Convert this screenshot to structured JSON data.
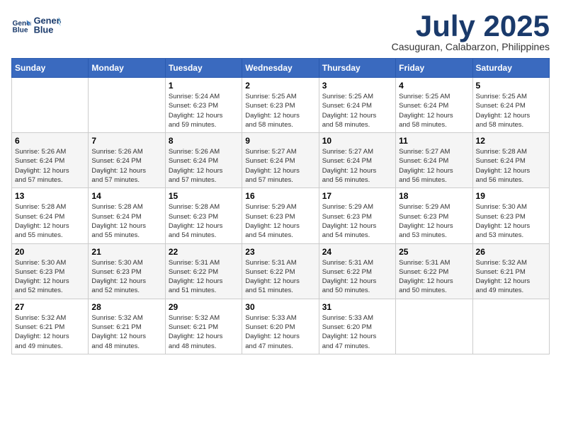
{
  "header": {
    "logo_line1": "General",
    "logo_line2": "Blue",
    "month": "July 2025",
    "location": "Casuguran, Calabarzon, Philippines"
  },
  "days_of_week": [
    "Sunday",
    "Monday",
    "Tuesday",
    "Wednesday",
    "Thursday",
    "Friday",
    "Saturday"
  ],
  "weeks": [
    [
      {
        "day": "",
        "content": ""
      },
      {
        "day": "",
        "content": ""
      },
      {
        "day": "1",
        "content": "Sunrise: 5:24 AM\nSunset: 6:23 PM\nDaylight: 12 hours\nand 59 minutes."
      },
      {
        "day": "2",
        "content": "Sunrise: 5:25 AM\nSunset: 6:23 PM\nDaylight: 12 hours\nand 58 minutes."
      },
      {
        "day": "3",
        "content": "Sunrise: 5:25 AM\nSunset: 6:24 PM\nDaylight: 12 hours\nand 58 minutes."
      },
      {
        "day": "4",
        "content": "Sunrise: 5:25 AM\nSunset: 6:24 PM\nDaylight: 12 hours\nand 58 minutes."
      },
      {
        "day": "5",
        "content": "Sunrise: 5:25 AM\nSunset: 6:24 PM\nDaylight: 12 hours\nand 58 minutes."
      }
    ],
    [
      {
        "day": "6",
        "content": "Sunrise: 5:26 AM\nSunset: 6:24 PM\nDaylight: 12 hours\nand 57 minutes."
      },
      {
        "day": "7",
        "content": "Sunrise: 5:26 AM\nSunset: 6:24 PM\nDaylight: 12 hours\nand 57 minutes."
      },
      {
        "day": "8",
        "content": "Sunrise: 5:26 AM\nSunset: 6:24 PM\nDaylight: 12 hours\nand 57 minutes."
      },
      {
        "day": "9",
        "content": "Sunrise: 5:27 AM\nSunset: 6:24 PM\nDaylight: 12 hours\nand 57 minutes."
      },
      {
        "day": "10",
        "content": "Sunrise: 5:27 AM\nSunset: 6:24 PM\nDaylight: 12 hours\nand 56 minutes."
      },
      {
        "day": "11",
        "content": "Sunrise: 5:27 AM\nSunset: 6:24 PM\nDaylight: 12 hours\nand 56 minutes."
      },
      {
        "day": "12",
        "content": "Sunrise: 5:28 AM\nSunset: 6:24 PM\nDaylight: 12 hours\nand 56 minutes."
      }
    ],
    [
      {
        "day": "13",
        "content": "Sunrise: 5:28 AM\nSunset: 6:24 PM\nDaylight: 12 hours\nand 55 minutes."
      },
      {
        "day": "14",
        "content": "Sunrise: 5:28 AM\nSunset: 6:24 PM\nDaylight: 12 hours\nand 55 minutes."
      },
      {
        "day": "15",
        "content": "Sunrise: 5:28 AM\nSunset: 6:23 PM\nDaylight: 12 hours\nand 54 minutes."
      },
      {
        "day": "16",
        "content": "Sunrise: 5:29 AM\nSunset: 6:23 PM\nDaylight: 12 hours\nand 54 minutes."
      },
      {
        "day": "17",
        "content": "Sunrise: 5:29 AM\nSunset: 6:23 PM\nDaylight: 12 hours\nand 54 minutes."
      },
      {
        "day": "18",
        "content": "Sunrise: 5:29 AM\nSunset: 6:23 PM\nDaylight: 12 hours\nand 53 minutes."
      },
      {
        "day": "19",
        "content": "Sunrise: 5:30 AM\nSunset: 6:23 PM\nDaylight: 12 hours\nand 53 minutes."
      }
    ],
    [
      {
        "day": "20",
        "content": "Sunrise: 5:30 AM\nSunset: 6:23 PM\nDaylight: 12 hours\nand 52 minutes."
      },
      {
        "day": "21",
        "content": "Sunrise: 5:30 AM\nSunset: 6:23 PM\nDaylight: 12 hours\nand 52 minutes."
      },
      {
        "day": "22",
        "content": "Sunrise: 5:31 AM\nSunset: 6:22 PM\nDaylight: 12 hours\nand 51 minutes."
      },
      {
        "day": "23",
        "content": "Sunrise: 5:31 AM\nSunset: 6:22 PM\nDaylight: 12 hours\nand 51 minutes."
      },
      {
        "day": "24",
        "content": "Sunrise: 5:31 AM\nSunset: 6:22 PM\nDaylight: 12 hours\nand 50 minutes."
      },
      {
        "day": "25",
        "content": "Sunrise: 5:31 AM\nSunset: 6:22 PM\nDaylight: 12 hours\nand 50 minutes."
      },
      {
        "day": "26",
        "content": "Sunrise: 5:32 AM\nSunset: 6:21 PM\nDaylight: 12 hours\nand 49 minutes."
      }
    ],
    [
      {
        "day": "27",
        "content": "Sunrise: 5:32 AM\nSunset: 6:21 PM\nDaylight: 12 hours\nand 49 minutes."
      },
      {
        "day": "28",
        "content": "Sunrise: 5:32 AM\nSunset: 6:21 PM\nDaylight: 12 hours\nand 48 minutes."
      },
      {
        "day": "29",
        "content": "Sunrise: 5:32 AM\nSunset: 6:21 PM\nDaylight: 12 hours\nand 48 minutes."
      },
      {
        "day": "30",
        "content": "Sunrise: 5:33 AM\nSunset: 6:20 PM\nDaylight: 12 hours\nand 47 minutes."
      },
      {
        "day": "31",
        "content": "Sunrise: 5:33 AM\nSunset: 6:20 PM\nDaylight: 12 hours\nand 47 minutes."
      },
      {
        "day": "",
        "content": ""
      },
      {
        "day": "",
        "content": ""
      }
    ]
  ]
}
